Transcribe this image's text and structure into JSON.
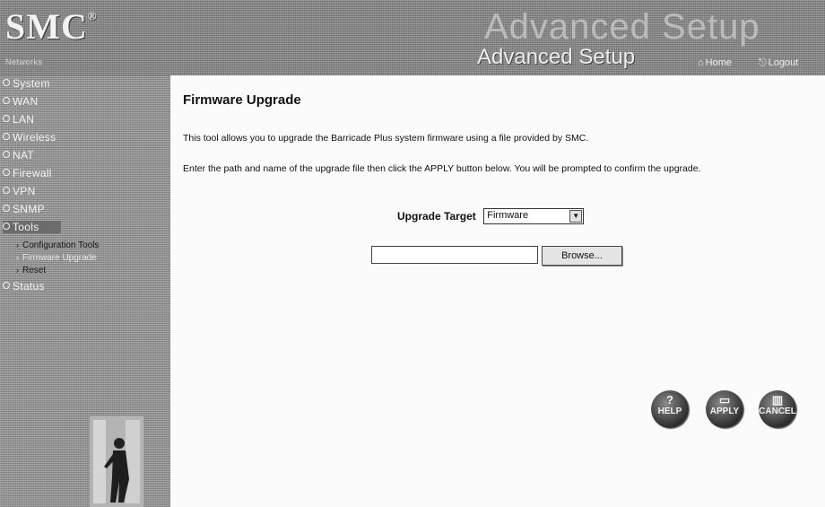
{
  "header": {
    "logo": "SMC",
    "logo_mark": "®",
    "tagline": "Networks",
    "background_word": "Advanced Setup",
    "section_title": "Advanced Setup",
    "nav": {
      "home_label": "Home",
      "home_icon": "home-icon",
      "logout_label": "Logout",
      "logout_icon": "logout-icon"
    }
  },
  "sidebar": {
    "items": [
      {
        "label": "System"
      },
      {
        "label": "WAN"
      },
      {
        "label": "LAN"
      },
      {
        "label": "Wireless"
      },
      {
        "label": "NAT"
      },
      {
        "label": "Firewall"
      },
      {
        "label": "VPN"
      },
      {
        "label": "SNMP"
      },
      {
        "label": "Tools"
      },
      {
        "label": "Status"
      }
    ],
    "subitems": [
      {
        "label": "Configuration Tools"
      },
      {
        "label": "Firmware Upgrade"
      },
      {
        "label": "Reset"
      }
    ],
    "active_item": "Tools",
    "active_subitem": "Firmware Upgrade"
  },
  "main": {
    "title": "Firmware Upgrade",
    "intro": "This tool allows you to upgrade the Barricade Plus system firmware using a file provided by SMC.",
    "instructions": "Enter the path and name of the upgrade file then click the APPLY button below. You will be prompted to confirm the upgrade.",
    "upgrade_target": {
      "label": "Upgrade Target",
      "selected": "Firmware"
    },
    "file": {
      "value": "",
      "browse_label": "Browse..."
    },
    "buttons": {
      "help": "HELP",
      "apply": "APPLY",
      "cancel": "CANCEL"
    }
  },
  "colors": {
    "header_bg": "#7a7a7a",
    "sidebar_bg": "#9a9a9a",
    "page_bg": "#fbfbfb",
    "button_bg": "#3a3a3a"
  }
}
